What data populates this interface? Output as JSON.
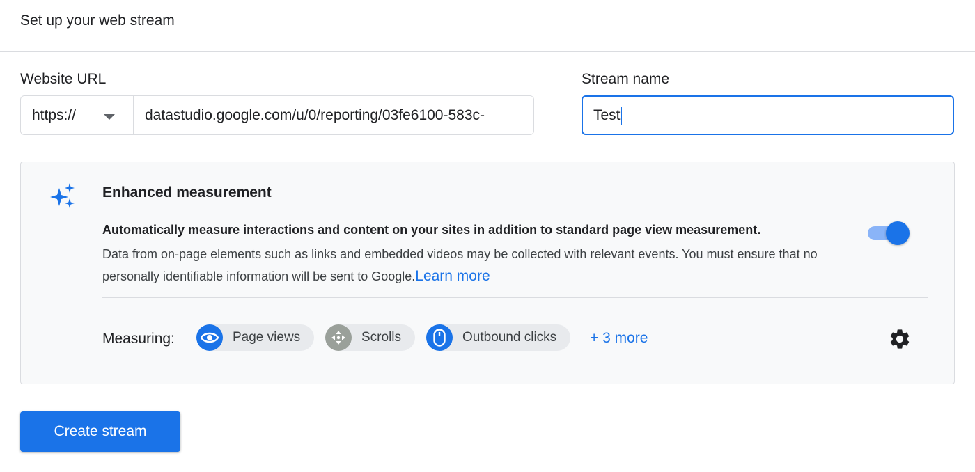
{
  "header": {
    "title": "Set up your web stream"
  },
  "website_url": {
    "label": "Website URL",
    "protocol": "https://",
    "value": "datastudio.google.com/u/0/reporting/03fe6100-583c-"
  },
  "stream_name": {
    "label": "Stream name",
    "value": "Test"
  },
  "enhanced_measurement": {
    "icon": "sparkle-icon",
    "title": "Enhanced measurement",
    "description_bold": "Automatically measure interactions and content on your sites in addition to standard page view measurement.",
    "description": "Data from on-page elements such as links and embedded videos may be collected with relevant events. You must ensure that no personally identifiable information will be sent to Google.",
    "learn_more": "Learn more",
    "enabled": true,
    "measuring_label": "Measuring:",
    "chips": [
      {
        "label": "Page views",
        "icon": "eye-icon",
        "color": "#1a73e8"
      },
      {
        "label": "Scrolls",
        "icon": "scroll-arrows-icon",
        "color": "#9aa09a"
      },
      {
        "label": "Outbound clicks",
        "icon": "mouse-icon",
        "color": "#1a73e8"
      }
    ],
    "more": "+ 3 more",
    "settings_icon": "gear-icon"
  },
  "create_button": {
    "label": "Create stream"
  },
  "colors": {
    "accent": "#1a73e8",
    "toggle_track": "#8ab4f8",
    "divider": "#dadce0"
  }
}
